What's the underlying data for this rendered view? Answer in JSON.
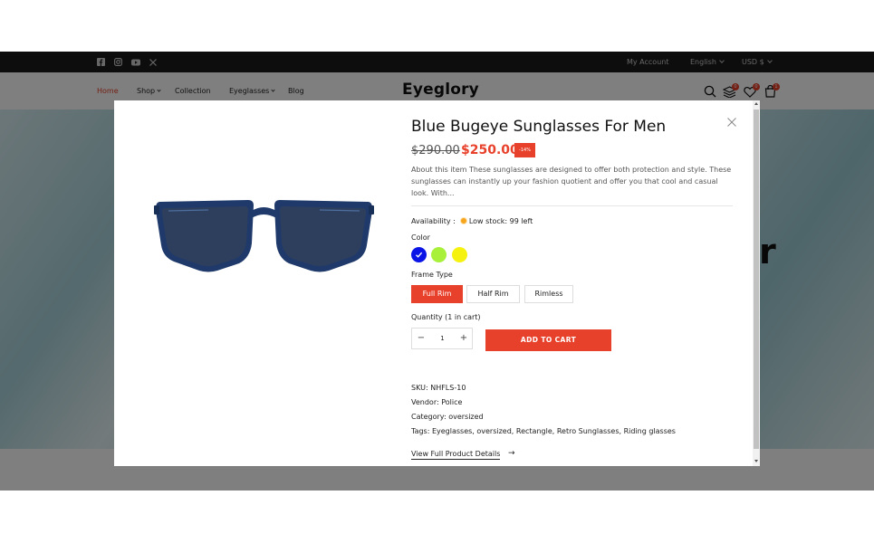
{
  "topbar": {
    "social_icons": [
      "facebook-icon",
      "instagram-icon",
      "youtube-icon",
      "x-icon"
    ],
    "account_label": "My Account",
    "language_label": "English",
    "currency_label": "USD $"
  },
  "header": {
    "nav": [
      "Home",
      "Shop",
      "Collection",
      "Eyeglasses",
      "Blog"
    ],
    "active_nav": "Home",
    "logo": "Eyeglory",
    "compare_count": "0",
    "wishlist_count": "0",
    "cart_count": "1"
  },
  "hero": {
    "partial_text": "r"
  },
  "product": {
    "title": "Blue Bugeye Sunglasses For Men",
    "old_price": "$290.00",
    "new_price": "$250.00",
    "discount_badge": "-14%",
    "description": "About this item These sunglasses are designed to offer both protection and style. These sunglasses can instantly up your fashion quotient and offer you that cool and casual look. With...",
    "availability_label": "Availability :",
    "stock_text": "Low stock: 99 left",
    "color_label": "Color",
    "colors": [
      "#0a14e6",
      "#a8f03a",
      "#f5f20f"
    ],
    "selected_color_index": 0,
    "frame_type_label": "Frame Type",
    "frame_types": [
      "Full Rim",
      "Half Rim",
      "Rimless"
    ],
    "selected_frame_type": "Full Rim",
    "quantity_label": "Quantity (1 in cart)",
    "quantity_minus": "−",
    "quantity_value": "1",
    "quantity_plus": "+",
    "add_to_cart": "ADD TO CART",
    "sku": "SKU: NHFLS-10",
    "vendor": "Vendor: Police",
    "category": "Category: oversized",
    "tags": "Tags: Eyeglasses, oversized, Rectangle, Retro Sunglasses, Riding glasses",
    "view_full": "View Full Product Details",
    "arrow": "→"
  },
  "accent_color": "#e8412b"
}
